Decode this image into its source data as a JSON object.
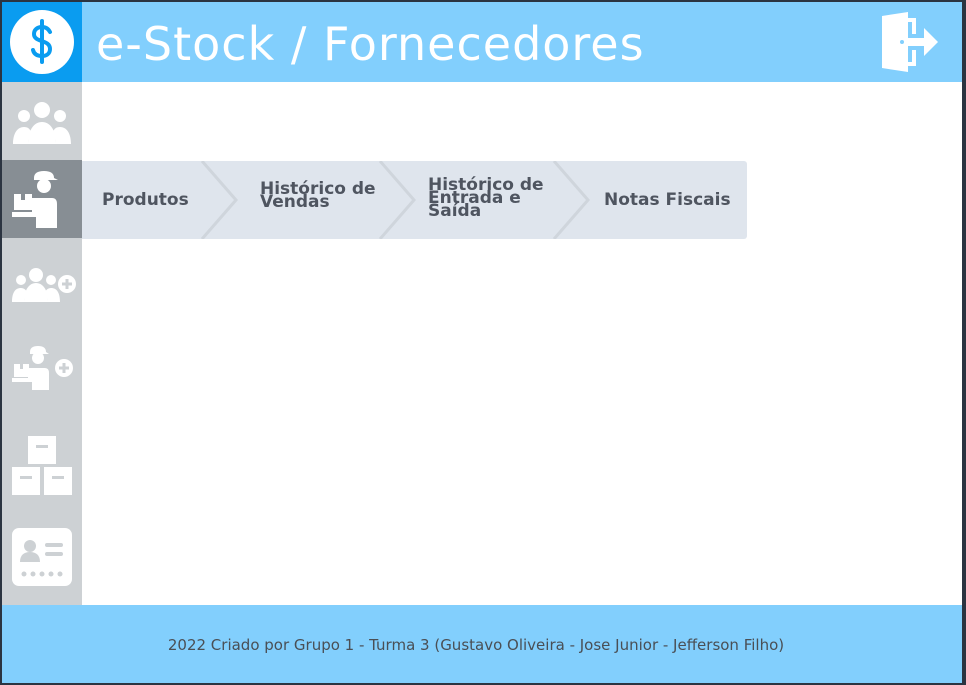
{
  "header": {
    "title": "e-Stock / Fornecedores",
    "logo_icon": "dollar-icon",
    "logout_icon": "logout-icon"
  },
  "sidebar": {
    "items": [
      {
        "icon": "users-group-icon",
        "active": false
      },
      {
        "icon": "supplier-icon",
        "active": true
      },
      {
        "icon": "users-add-icon",
        "active": false
      },
      {
        "icon": "supplier-add-icon",
        "active": false
      },
      {
        "icon": "boxes-icon",
        "active": false
      },
      {
        "icon": "id-card-icon",
        "active": false
      }
    ]
  },
  "menu": {
    "items": [
      {
        "label": "Produtos"
      },
      {
        "label": "Histórico de Vendas"
      },
      {
        "label": "Histórico de Entrada e Saída"
      },
      {
        "label": "Notas Fiscais"
      }
    ]
  },
  "footer": {
    "text": "2022 Criado por Grupo 1 - Turma 3 (Gustavo Oliveira - Jose Junior - Jefferson Filho)"
  },
  "colors": {
    "header_bg": "#82cffd",
    "logo_bg": "#0a9cf0",
    "sidebar_bg": "#cdd1d4",
    "sidebar_active": "#878e94",
    "menu_bg": "#dfe5ed",
    "menu_text": "#4f5560"
  }
}
